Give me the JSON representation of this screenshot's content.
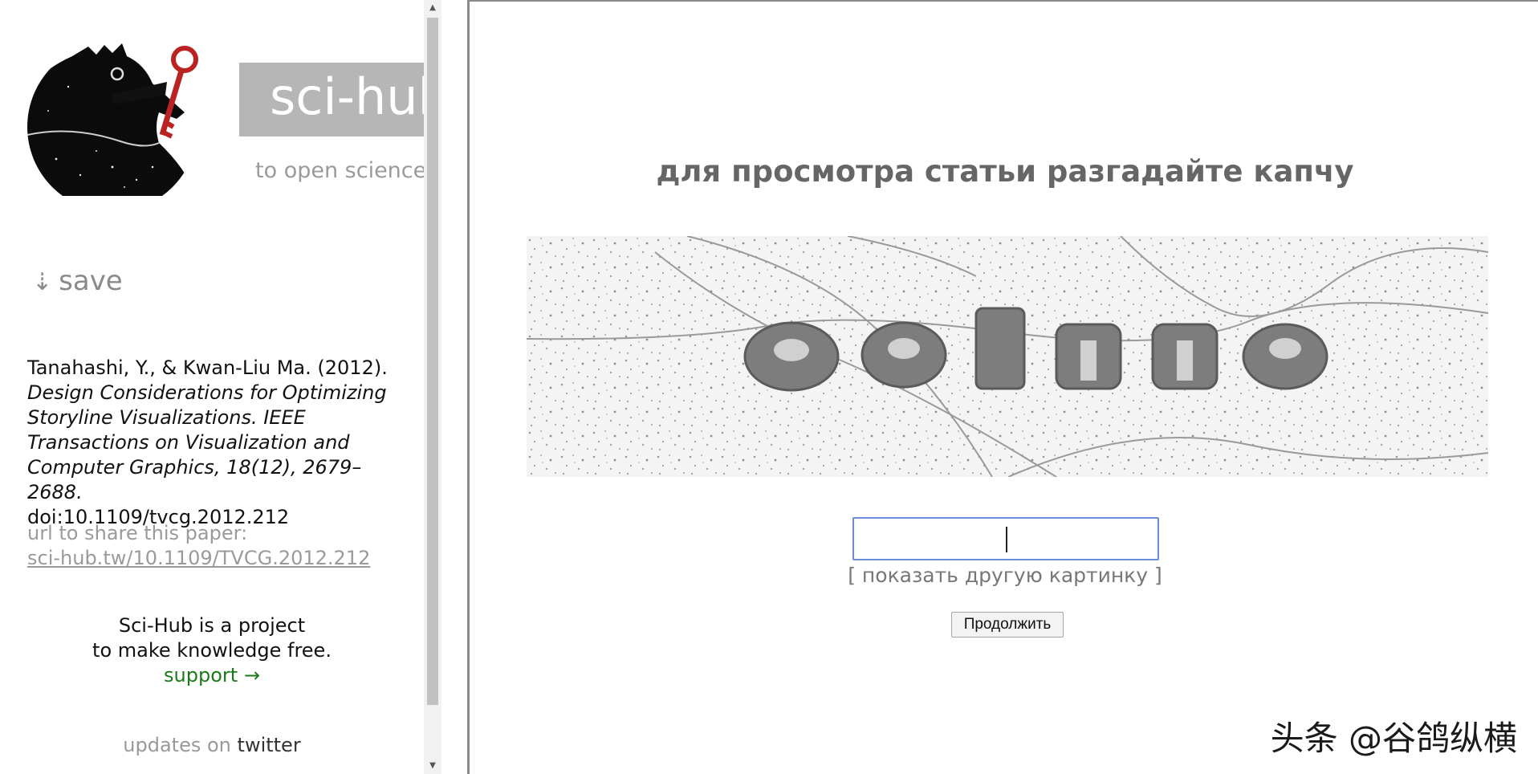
{
  "menu": {
    "brand": "sci-hub",
    "tagline": "to open science",
    "save_label": "save",
    "save_arrow": "⇣",
    "citation": {
      "authors": "Tanahashi, Y., & Kwan-Liu Ma. (2012).",
      "title_journal": "Design Considerations for Optimizing Storyline Visualizations. IEEE Transactions on Visualization and Computer Graphics, 18(12), 2679–2688.",
      "doi": "doi:10.1109/tvcg.2012.212"
    },
    "share_label": "url to share this paper:",
    "share_url": "sci-hub.tw/10.1109/TVCG.2012.212",
    "project_line1": "Sci-Hub is a project",
    "project_line2": "to make knowledge free.",
    "support_label": "support →",
    "updates_label": "updates on",
    "twitter_label": "twitter"
  },
  "captcha": {
    "title": "для просмотра статьи разгадайте капчу",
    "image_text": "ostuna",
    "input_value": "",
    "reload_label": "[ показать другую картинку ]",
    "continue_label": "Продолжить"
  },
  "watermark": "头条 @谷鸽纵横",
  "colors": {
    "brand_bg": "#b6b6b6",
    "support": "#1a7a1a",
    "input_border": "#6a8ed6",
    "title": "#666666"
  }
}
